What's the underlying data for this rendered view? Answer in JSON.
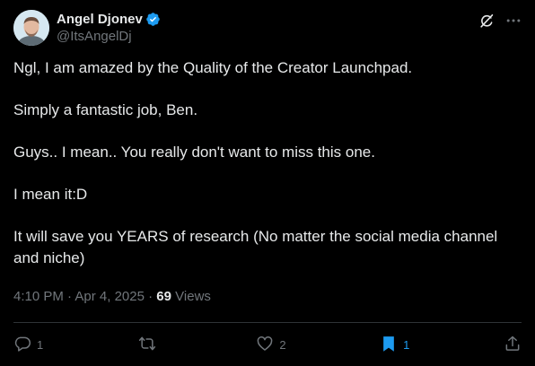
{
  "author": {
    "name": "Angel Djonev",
    "handle": "@ItsAngelDj",
    "verified": true
  },
  "post": {
    "paragraphs": [
      "Ngl, I am amazed by the Quality of the Creator Launchpad.",
      "Simply a fantastic job, Ben.",
      "Guys.. I mean.. You really don't want to miss this one.",
      "I mean it:D",
      "It will save you YEARS of research (No matter the  social media channel and niche)"
    ],
    "time": "4:10 PM",
    "separator": "·",
    "date": "Apr 4, 2025",
    "views_count": "69",
    "views_label": "Views"
  },
  "actions": {
    "replies": "1",
    "reposts": "",
    "likes": "2",
    "bookmarks": "1"
  },
  "colors": {
    "background": "#000000",
    "text": "#e7e9ea",
    "muted": "#71767b",
    "accent": "#1d9bf0"
  },
  "icons": [
    "grok-icon",
    "more-icon",
    "reply-icon",
    "repost-icon",
    "like-icon",
    "bookmark-icon",
    "share-icon",
    "verified-badge-icon"
  ]
}
